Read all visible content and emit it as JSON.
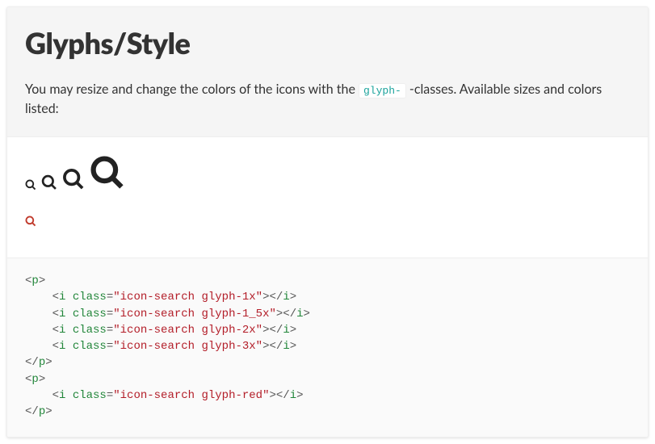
{
  "header": {
    "title": "Glyphs/Style",
    "desc_before": "You may resize and change the colors of the icons with the ",
    "code": "glyph-",
    "desc_after": " -classes. Available sizes and colors listed:"
  },
  "code": {
    "lines": [
      {
        "indent": 0,
        "type": "open",
        "tag": "p"
      },
      {
        "indent": 1,
        "type": "icon",
        "tag": "i",
        "attr": "class",
        "value": "icon-search glyph-1x"
      },
      {
        "indent": 1,
        "type": "icon",
        "tag": "i",
        "attr": "class",
        "value": "icon-search glyph-1_5x"
      },
      {
        "indent": 1,
        "type": "icon",
        "tag": "i",
        "attr": "class",
        "value": "icon-search glyph-2x"
      },
      {
        "indent": 1,
        "type": "icon",
        "tag": "i",
        "attr": "class",
        "value": "icon-search glyph-3x"
      },
      {
        "indent": 0,
        "type": "close",
        "tag": "p"
      },
      {
        "indent": 0,
        "type": "open",
        "tag": "p"
      },
      {
        "indent": 1,
        "type": "icon",
        "tag": "i",
        "attr": "class",
        "value": "icon-search glyph-red"
      },
      {
        "indent": 0,
        "type": "close",
        "tag": "p"
      }
    ]
  }
}
